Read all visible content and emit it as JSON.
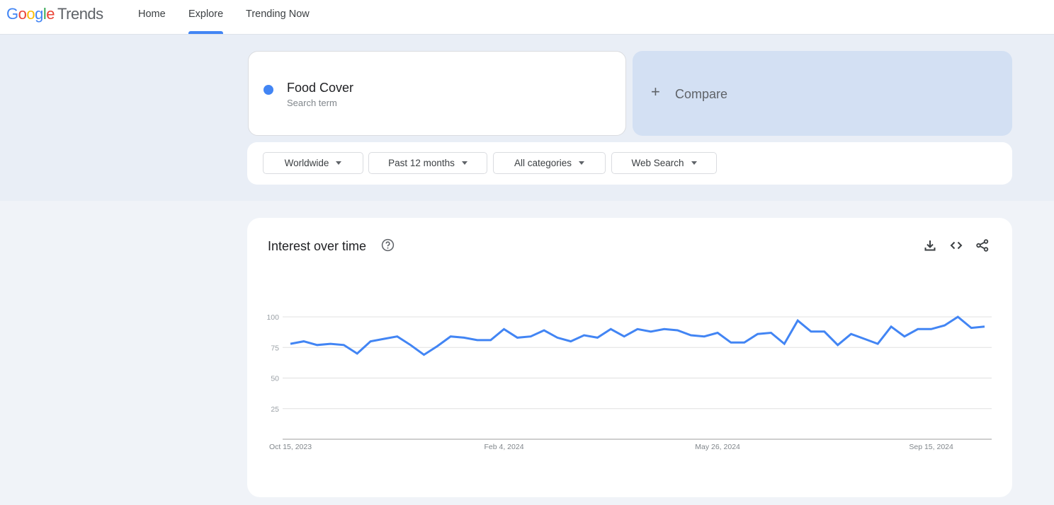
{
  "header": {
    "logo_google": [
      "G",
      "o",
      "o",
      "g",
      "l",
      "e"
    ],
    "logo_product": "Trends",
    "nav": [
      {
        "label": "Home",
        "active": false
      },
      {
        "label": "Explore",
        "active": true
      },
      {
        "label": "Trending Now",
        "active": false
      }
    ]
  },
  "search": {
    "term": "Food Cover",
    "term_type": "Search term",
    "term_color": "#4285f4",
    "compare_icon": "plus-icon",
    "compare_label": "Compare"
  },
  "filters": [
    {
      "label": "Worldwide"
    },
    {
      "label": "Past 12 months"
    },
    {
      "label": "All categories"
    },
    {
      "label": "Web Search"
    }
  ],
  "panel": {
    "title": "Interest over time",
    "icons": [
      "help-icon",
      "download-icon",
      "embed-code-icon",
      "share-icon"
    ]
  },
  "chart_data": {
    "type": "line",
    "title": "Interest over time",
    "xlabel": "",
    "ylabel": "",
    "ylim": [
      0,
      100
    ],
    "yticks": [
      25,
      50,
      75,
      100
    ],
    "xtick_labels": [
      {
        "label": "Oct 15, 2023",
        "index": 0
      },
      {
        "label": "Feb 4, 2024",
        "index": 16
      },
      {
        "label": "May 26, 2024",
        "index": 32
      },
      {
        "label": "Sep 15, 2024",
        "index": 48
      }
    ],
    "grid": true,
    "legend": "none",
    "series": [
      {
        "name": "Food Cover",
        "color": "#4285f4",
        "values": [
          78,
          80,
          77,
          78,
          77,
          70,
          80,
          82,
          84,
          77,
          69,
          76,
          84,
          83,
          81,
          81,
          90,
          83,
          84,
          89,
          83,
          80,
          85,
          83,
          90,
          84,
          90,
          88,
          90,
          89,
          85,
          84,
          87,
          79,
          79,
          86,
          87,
          78,
          97,
          88,
          88,
          77,
          86,
          82,
          78,
          92,
          84,
          90,
          90,
          93,
          100,
          91,
          92
        ]
      }
    ]
  }
}
